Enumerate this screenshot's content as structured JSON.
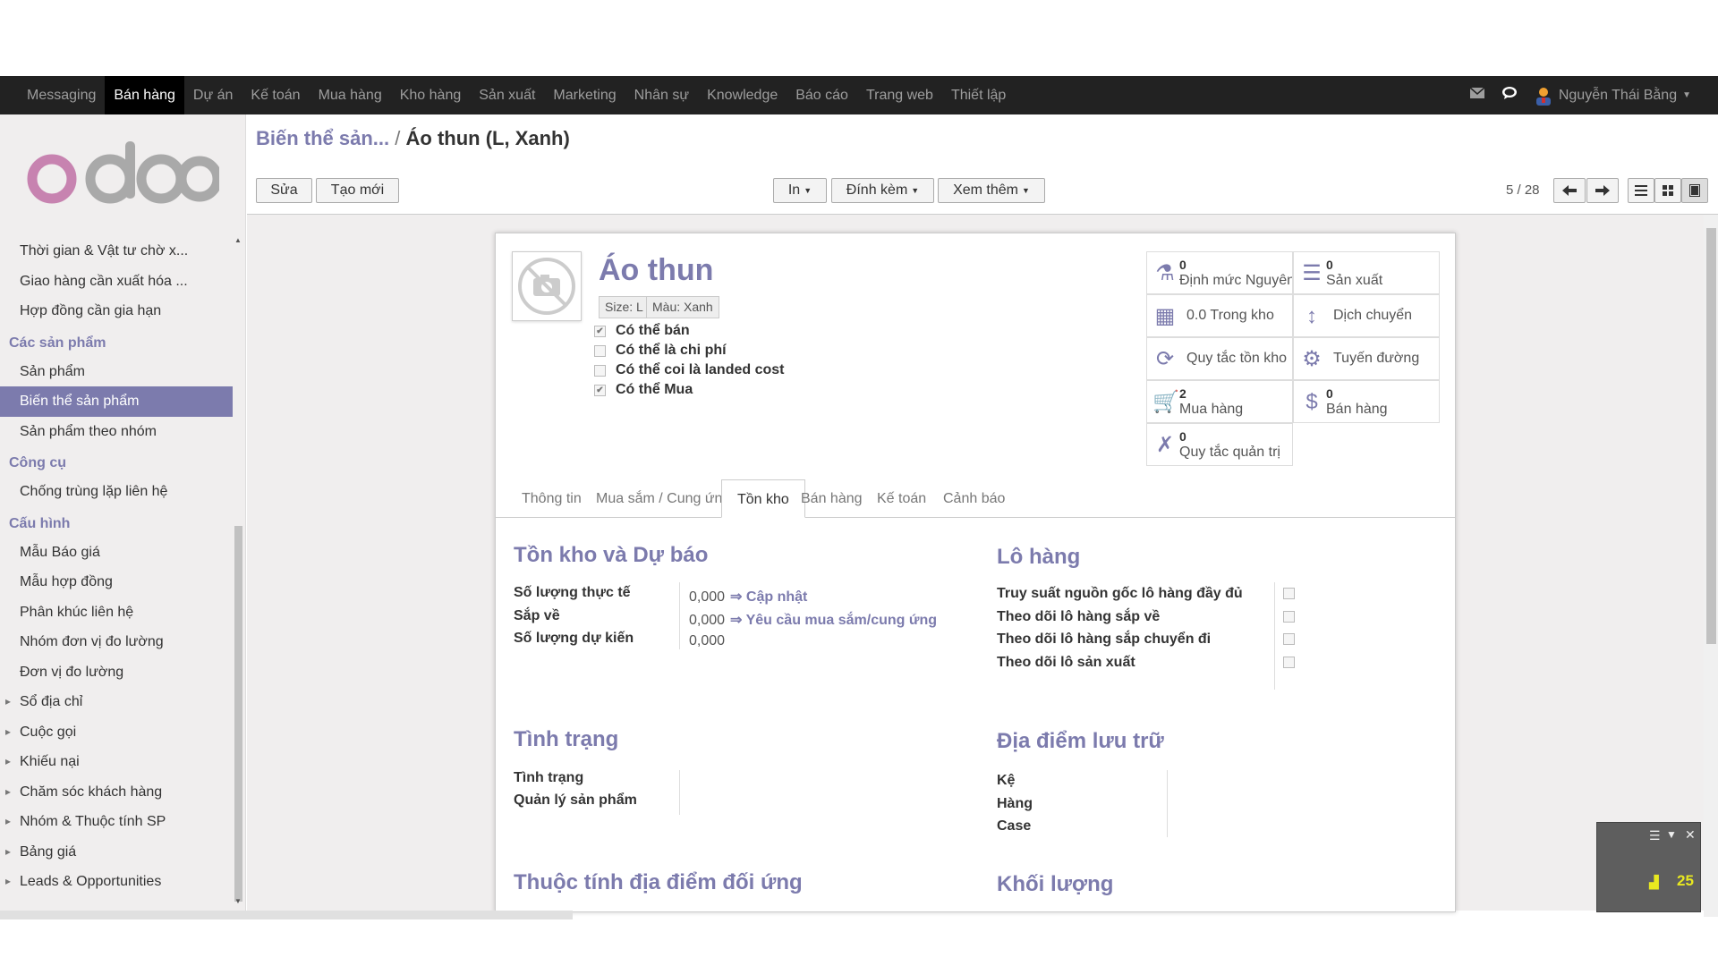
{
  "nav": {
    "items": [
      "Messaging",
      "Bán hàng",
      "Dự án",
      "Kế toán",
      "Mua hàng",
      "Kho hàng",
      "Sản xuất",
      "Marketing",
      "Nhân sự",
      "Knowledge",
      "Báo cáo",
      "Trang web",
      "Thiết lập"
    ],
    "active_index": 1,
    "user": "Nguyễn Thái Bằng"
  },
  "sidebar": {
    "items": [
      {
        "type": "item",
        "label": "Thời gian & Vật tư chờ x..."
      },
      {
        "type": "item",
        "label": "Giao hàng cần xuất hóa ..."
      },
      {
        "type": "item",
        "label": "Hợp đồng cần gia hạn"
      },
      {
        "type": "head",
        "label": "Các sản phẩm"
      },
      {
        "type": "item",
        "label": "Sản phẩm"
      },
      {
        "type": "item",
        "label": "Biến thể sản phẩm",
        "active": true
      },
      {
        "type": "item",
        "label": "Sản phẩm theo nhóm"
      },
      {
        "type": "head",
        "label": "Công cụ"
      },
      {
        "type": "item",
        "label": "Chống trùng lặp liên hệ"
      },
      {
        "type": "head",
        "label": "Cấu hình"
      },
      {
        "type": "item",
        "label": "Mẫu Báo giá"
      },
      {
        "type": "item",
        "label": "Mẫu hợp đồng"
      },
      {
        "type": "item",
        "label": "Phân khúc liên hệ"
      },
      {
        "type": "item",
        "label": "Nhóm đơn vị đo lường"
      },
      {
        "type": "item",
        "label": "Đơn vị đo lường"
      },
      {
        "type": "tri",
        "label": "Sổ địa chỉ"
      },
      {
        "type": "tri",
        "label": "Cuộc gọi"
      },
      {
        "type": "tri",
        "label": "Khiếu nại"
      },
      {
        "type": "tri",
        "label": "Chăm sóc khách hàng"
      },
      {
        "type": "tri",
        "label": "Nhóm & Thuộc tính SP"
      },
      {
        "type": "tri",
        "label": "Bảng giá"
      },
      {
        "type": "tri",
        "label": "Leads & Opportunities"
      }
    ]
  },
  "breadcrumb": {
    "parent": "Biến thể sản...",
    "sep": "/",
    "current": "Áo thun (L, Xanh)"
  },
  "toolbar": {
    "edit": "Sửa",
    "create": "Tạo mới",
    "print": "In",
    "attach": "Đính kèm",
    "more": "Xem thêm",
    "pager": "5 / 28"
  },
  "product": {
    "name": "Áo thun",
    "tags": [
      "Size: L",
      "Màu: Xanh"
    ],
    "checks": [
      {
        "label": "Có thể bán",
        "checked": true
      },
      {
        "label": "Có thể là chi phí",
        "checked": false
      },
      {
        "label": "Có thể coi là landed cost",
        "checked": false
      },
      {
        "label": "Có thể Mua",
        "checked": true
      }
    ]
  },
  "smart_buttons": [
    {
      "icon": "flask-icon",
      "num": "0",
      "label": "Định mức Nguyên"
    },
    {
      "icon": "list-icon",
      "num": "0",
      "label": "Sản xuất"
    },
    {
      "icon": "building-icon",
      "num": "",
      "label": "0.0 Trong kho"
    },
    {
      "icon": "arrows-vertical-icon",
      "num": "",
      "label": "Dịch chuyển"
    },
    {
      "icon": "refresh-icon",
      "num": "",
      "label": "Quy tắc tồn kho"
    },
    {
      "icon": "gears-icon",
      "num": "",
      "label": "Tuyến đường"
    },
    {
      "icon": "cart-icon",
      "num": "2",
      "label": "Mua hàng"
    },
    {
      "icon": "dollar-icon",
      "num": "0",
      "label": "Bán hàng"
    },
    {
      "icon": "xing-icon",
      "num": "0",
      "label": "Quy tắc quản trị"
    }
  ],
  "tabs": [
    "Thông tin",
    "Mua sắm / Cung ứng",
    "Tồn kho",
    "Bán hàng",
    "Kế toán",
    "Cảnh báo"
  ],
  "active_tab": 2,
  "sections": {
    "stock": {
      "title": "Tồn kho và Dự báo",
      "rows": [
        {
          "label": "Số lượng thực tế",
          "value": "0,000",
          "link": "⇒ Cập nhật"
        },
        {
          "label": "Sắp về",
          "value": "0,000",
          "link": "⇒ Yêu cầu mua sắm/cung ứng"
        },
        {
          "label": "Số lượng dự kiến",
          "value": "0,000",
          "link": ""
        }
      ]
    },
    "lots": {
      "title": "Lô hàng",
      "rows": [
        "Truy suất nguồn gốc lô hàng đầy đủ",
        "Theo dõi lô hàng sắp về",
        "Theo dõi lô hàng sắp chuyển đi",
        "Theo dõi lô sản xuất"
      ]
    },
    "status": {
      "title": "Tình trạng",
      "rows": [
        "Tình trạng",
        "Quản lý sản phẩm"
      ]
    },
    "location": {
      "title": "Địa điểm lưu trữ",
      "rows": [
        "Kệ",
        "Hàng",
        "Case"
      ]
    },
    "counterpart": {
      "title": "Thuộc tính địa điểm đối ứng"
    },
    "weight": {
      "title": "Khối lượng"
    }
  },
  "widget": {
    "value": "25"
  }
}
